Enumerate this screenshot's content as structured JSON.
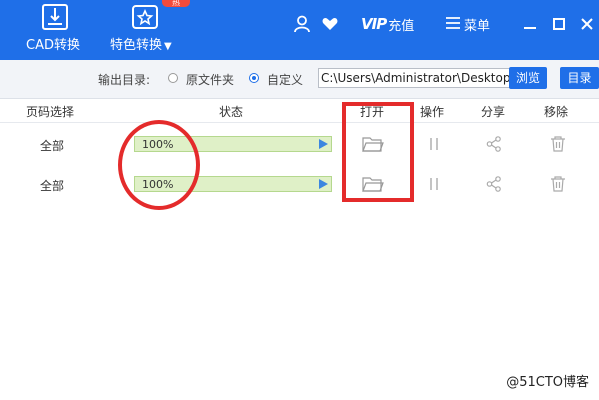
{
  "toolbar": {
    "cad_convert_label": "CAD转换",
    "special_convert_label": "特色转换",
    "hot_badge": "热",
    "vip_label": "VIP",
    "recharge_label": "充值",
    "menu_label": "菜单"
  },
  "output_dir": {
    "label": "输出目录:",
    "option_original": "原文件夹",
    "option_custom": "自定义",
    "selected": "自定义",
    "path_value": "C:\\Users\\Administrator\\Desktop",
    "browse_label": "浏览",
    "dir_label": "目录"
  },
  "table": {
    "headers": [
      "页码选择",
      "状态",
      "打开",
      "操作",
      "分享",
      "移除"
    ],
    "rows": [
      {
        "pages": "全部",
        "progress": 100,
        "progress_text": "100%"
      },
      {
        "pages": "全部",
        "progress": 100,
        "progress_text": "100%"
      }
    ]
  },
  "watermark": "@51CTO博客",
  "colors": {
    "accent": "#1f6fe8",
    "progress_fill": "#dff0c7",
    "annotation_red": "#e42b2b"
  }
}
